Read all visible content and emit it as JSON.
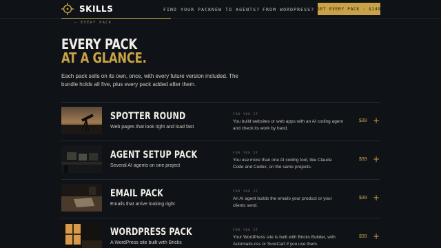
{
  "header": {
    "brand": "SKILLS",
    "nav": [
      {
        "label": "FIND YOUR PACK"
      },
      {
        "label": "NEW TO AGENTS?"
      },
      {
        "label": "FROM WORDPRESS?"
      }
    ],
    "cta": "GET EVERY PACK · $149"
  },
  "section_tag": "— EVERY PACK",
  "headline": {
    "line1": "EVERY PACK",
    "line2": "AT A GLANCE."
  },
  "lede": "Each pack sells on its own, once, with every future version included. The bundle holds all five, plus every pack added after them.",
  "packs": [
    {
      "title": "SPOTTER ROUND",
      "subtitle": "Web pages that look right and load fast",
      "for_label": "FOR YOU IF",
      "for_text": "You build websites or web apps with an AI coding agent and check its work by hand.",
      "price": "$39"
    },
    {
      "title": "AGENT SETUP PACK",
      "subtitle": "Several AI agents on one project",
      "for_label": "FOR YOU IF",
      "for_text": "You use more than one AI coding tool, like Claude Code and Codex, on the same projects.",
      "price": "$39"
    },
    {
      "title": "EMAIL PACK",
      "subtitle": "Emails that arrive looking right",
      "for_label": "FOR YOU IF",
      "for_text": "An AI agent builds the emails your product or your clients send.",
      "price": "$39"
    },
    {
      "title": "WORDPRESS PACK",
      "subtitle": "A WordPress site built with Bricks",
      "for_label": "FOR YOU IF",
      "for_text": "Your WordPress site is built with Bricks Builder, with Automatic.css or SureCart if you use them.",
      "price": "$39"
    }
  ],
  "colors": {
    "accent": "#c9a247",
    "background": "#0f1216"
  },
  "icons": {
    "brand": "crosshair-icon",
    "expand": "plus-icon"
  }
}
